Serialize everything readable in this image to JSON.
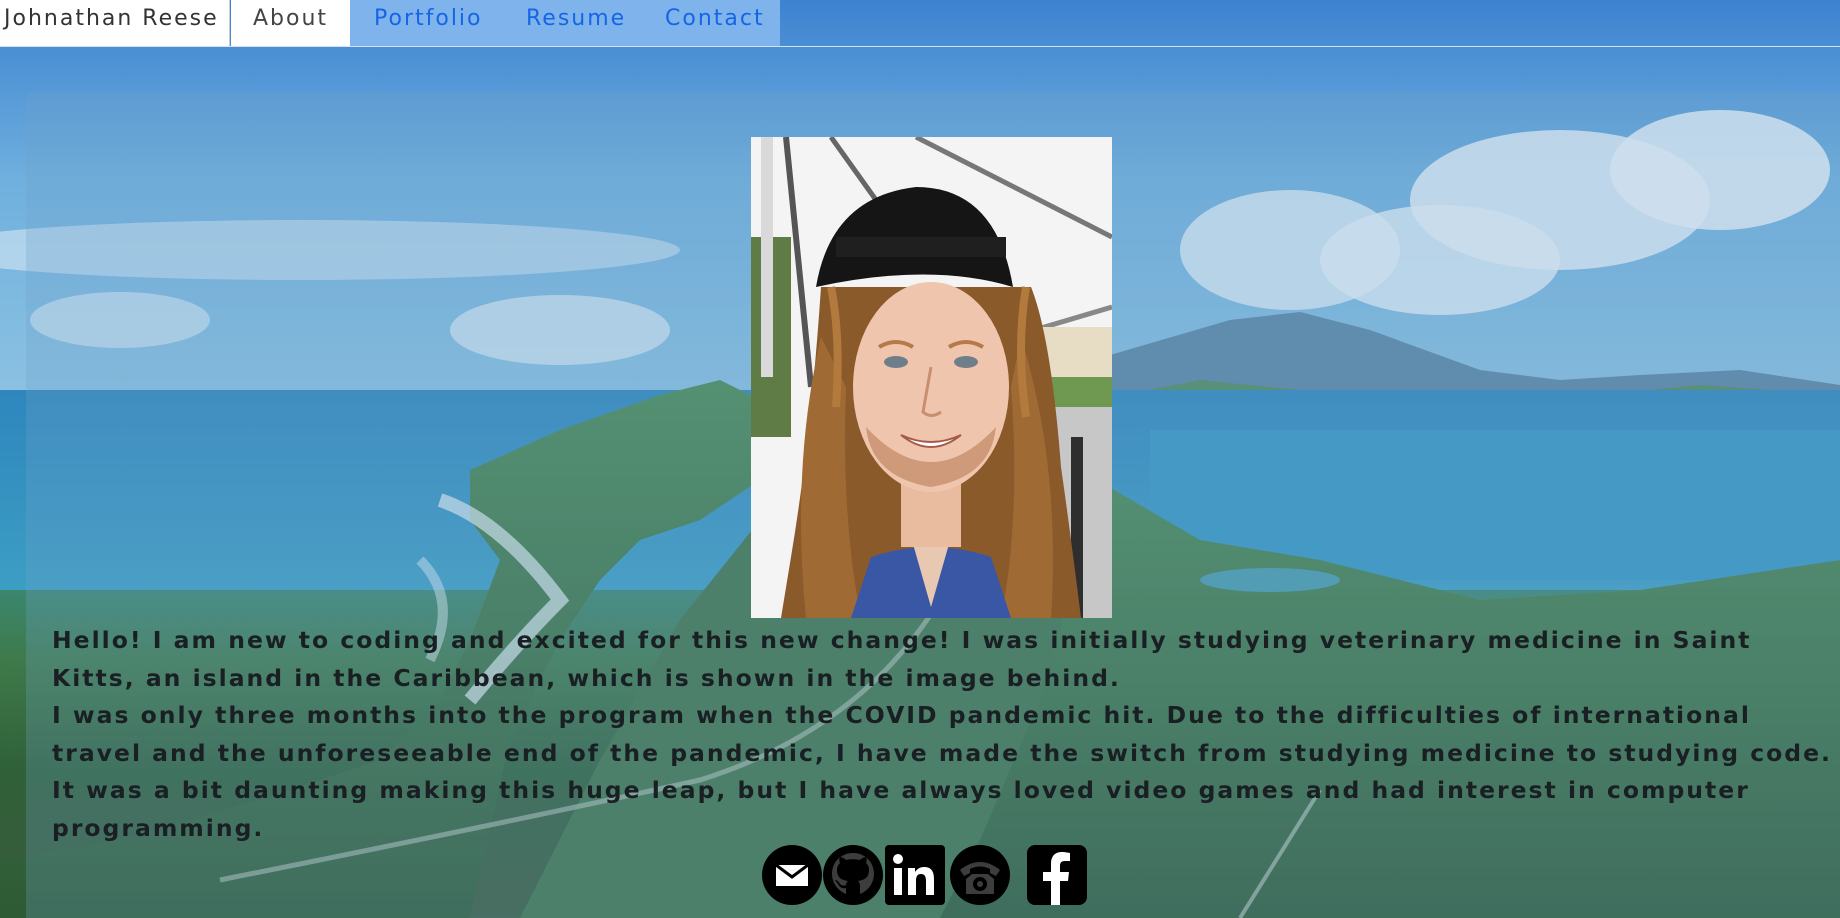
{
  "nav": {
    "brand": "Johnathan Reese",
    "items": [
      {
        "label": "About",
        "active": true
      },
      {
        "label": "Portfolio",
        "active": false
      },
      {
        "label": "Resume",
        "active": false
      },
      {
        "label": "Contact",
        "active": false
      }
    ]
  },
  "about": {
    "paragraph1": "Hello! I am new to coding and excited for this new change! I was initially studying veterinary medicine in Saint Kitts, an island in the Caribbean, which is shown in the image behind.",
    "paragraph2": "I was only three months into the program when the COVID pandemic hit. Due to the difficulties of international travel and the unforeseeable end of the pandemic, I have made the switch from studying medicine to studying code. It was a bit daunting making this huge leap, but I have always loved video games and had interest in computer programming."
  },
  "social": [
    {
      "icon": "email-icon"
    },
    {
      "icon": "github-icon"
    },
    {
      "icon": "linkedin-icon"
    },
    {
      "icon": "phone-icon"
    },
    {
      "icon": "facebook-icon"
    }
  ],
  "colors": {
    "nav_link": "#1565e6",
    "nav_strip": "#7fb3ec",
    "text": "#1a1f24"
  }
}
